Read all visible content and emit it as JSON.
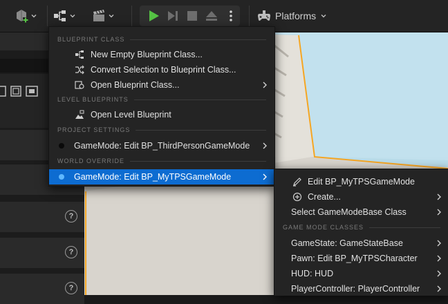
{
  "toolbar": {
    "platforms_label": "Platforms",
    "icons": [
      "add-content-icon",
      "blueprint-icon",
      "cinematics-icon",
      "play-icon",
      "step-icon",
      "stop-icon",
      "eject-icon",
      "more-options-icon",
      "platforms-icon"
    ]
  },
  "blueprint_menu": {
    "sections": {
      "blueprint_class": "BLUEPRINT CLASS",
      "level_blueprints": "LEVEL BLUEPRINTS",
      "project_settings": "PROJECT SETTINGS",
      "world_override": "WORLD OVERRIDE"
    },
    "items": {
      "new_empty": "New Empty Blueprint Class...",
      "convert_selection": "Convert Selection to Blueprint Class...",
      "open_class": "Open Blueprint Class...",
      "open_level": "Open Level Blueprint",
      "project_gamemode": "GameMode: Edit BP_ThirdPersonGameMode",
      "world_gamemode": "GameMode: Edit BP_MyTPSGameMode"
    }
  },
  "gamemode_submenu": {
    "items": {
      "edit": "Edit BP_MyTPSGameMode",
      "create": "Create...",
      "select_base": "Select GameModeBase Class"
    },
    "section_classes": "GAME MODE CLASSES",
    "classes": {
      "gamestate": "GameState: GameStateBase",
      "pawn": "Pawn: Edit BP_MyTPSCharacter",
      "hud": "HUD: HUD",
      "player_controller": "PlayerController: PlayerController"
    }
  },
  "colors": {
    "accent_highlight": "#0d6cd1",
    "selection_outline": "#f5a623",
    "play_green": "#55c244",
    "sky": "#b9dcea"
  }
}
